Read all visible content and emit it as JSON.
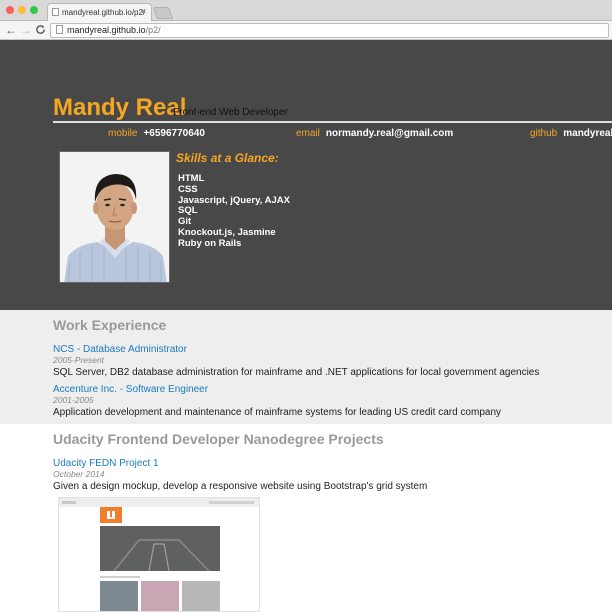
{
  "browser": {
    "tab_title": "mandyreal.github.io/p2/",
    "tab_close": "×",
    "url_host": "mandyreal.github.io",
    "url_path": "/p2/",
    "back": "←",
    "forward": "→",
    "reload": "C"
  },
  "header": {
    "name": "Mandy Real",
    "role": "Front-end Web Developer",
    "contacts": [
      {
        "label": "mobile",
        "value": "+6596770640"
      },
      {
        "label": "email",
        "value": "normandy.real@gmail.com"
      },
      {
        "label": "github",
        "value": "mandyreal"
      }
    ],
    "skills_title": "Skills at a Glance:",
    "skills": [
      "HTML",
      "CSS",
      "Javascript, jQuery, AJAX",
      "SQL",
      "Git",
      "Knockout.js, Jasmine",
      "Ruby on Rails"
    ]
  },
  "work": {
    "title": "Work Experience",
    "jobs": [
      {
        "title": "NCS - Database Administrator",
        "dates": "2005-Present",
        "desc": "SQL Server, DB2 database administration for mainframe and .NET applications for local government agencies"
      },
      {
        "title": "Accenture Inc. - Software Engineer",
        "dates": "2001-2005",
        "desc": "Application development and maintenance of mainframe systems for leading US credit card company"
      }
    ]
  },
  "projects": {
    "title": "Udacity Frontend Developer Nanodegree Projects",
    "items": [
      {
        "title": "Udacity FEDN Project 1",
        "date": "October 2014",
        "desc": "Given a design mockup, develop a responsive website using Bootstrap's grid system"
      }
    ]
  },
  "colors": {
    "accent": "#f5a623",
    "header_bg": "#484848",
    "link": "#1a7bbf",
    "work_bg": "#eeeeee"
  }
}
